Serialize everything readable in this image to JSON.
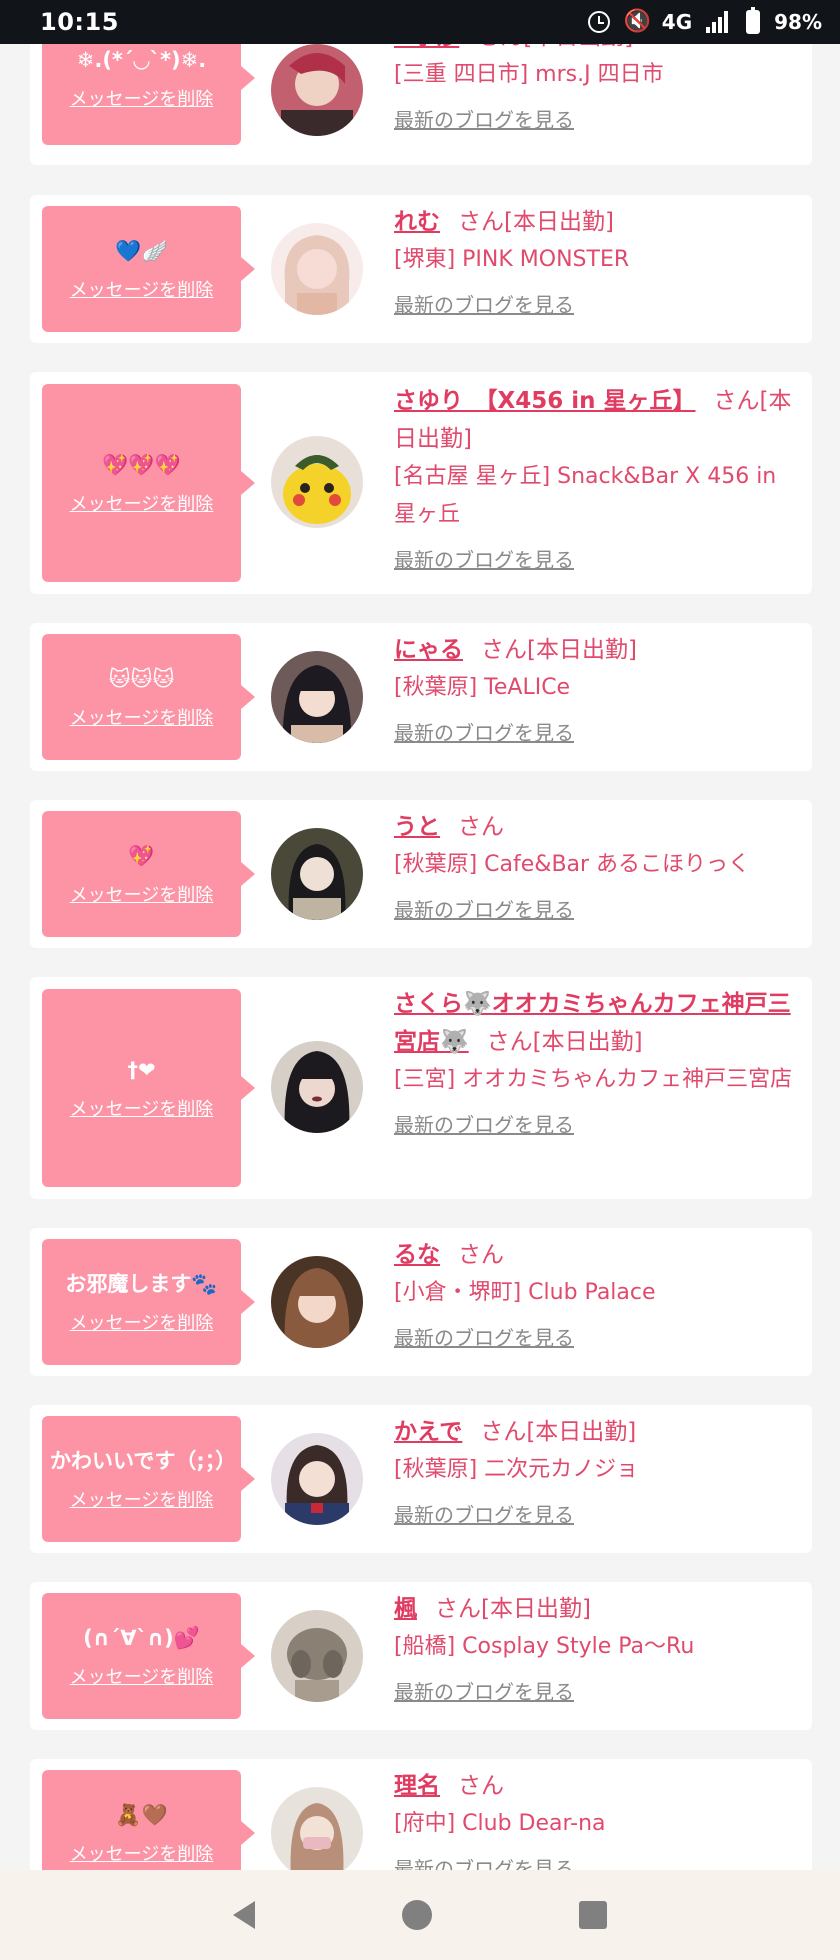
{
  "status_bar": {
    "time": "10:15",
    "network": "4G",
    "battery": "98%"
  },
  "cards": [
    {
      "msg": "❄.(*´◡`*)❄.",
      "delete": "メッセージを削除",
      "name": "❤季莎",
      "honor": "さん[本日出勤]",
      "shop": "[三重 四日市] mrs.J 四日市",
      "blog": "最新のブログを見る"
    },
    {
      "msg": "💙🪽",
      "delete": "メッセージを削除",
      "name": "れむ",
      "honor": "さん[本日出勤]",
      "shop": "[堺東] PINK MONSTER",
      "blog": "最新のブログを見る"
    },
    {
      "msg": "💖💖💖",
      "delete": "メッセージを削除",
      "name": "さゆり　【X456 in 星ヶ丘】",
      "honor": "さん[本日出勤]",
      "shop": "[名古屋 星ヶ丘] Snack&Bar X 456 in 星ヶ丘",
      "blog": "最新のブログを見る"
    },
    {
      "msg": "🐱🐱🐱",
      "delete": "メッセージを削除",
      "name": "にゃる",
      "honor": "さん[本日出勤]",
      "shop": "[秋葉原] TeALICe",
      "blog": "最新のブログを見る"
    },
    {
      "msg": "💖",
      "delete": "メッセージを削除",
      "name": "うと",
      "honor": "さん",
      "shop": "[秋葉原] Cafe&Bar あるこほりっく",
      "blog": "最新のブログを見る"
    },
    {
      "msg": "†❤",
      "delete": "メッセージを削除",
      "name": "さくら🐺オオカミちゃんカフェ神戸三宮店🐺",
      "honor": "さん[本日出勤]",
      "shop": "[三宮] オオカミちゃんカフェ神戸三宮店",
      "blog": "最新のブログを見る"
    },
    {
      "msg": "お邪魔します🐾",
      "delete": "メッセージを削除",
      "name": "るな",
      "honor": "さん",
      "shop": "[小倉・堺町] Club Palace",
      "blog": "最新のブログを見る"
    },
    {
      "msg": "かわいいです（;；）",
      "delete": "メッセージを削除",
      "name": "かえで",
      "honor": "さん[本日出勤]",
      "shop": "[秋葉原] 二次元カノジョ",
      "blog": "最新のブログを見る"
    },
    {
      "msg": "(∩´∀`∩)💕",
      "delete": "メッセージを削除",
      "name": "楓",
      "honor": "さん[本日出勤]",
      "shop": "[船橋] Cosplay Style Pa～Ru",
      "blog": "最新のブログを見る"
    },
    {
      "msg": "🧸🤎",
      "delete": "メッセージを削除",
      "name": "理名",
      "honor": "さん",
      "shop": "[府中] Club Dear-na",
      "blog": "最新のブログを見る"
    }
  ],
  "avatars": [
    {
      "label": "avatar-kisa",
      "colors": [
        "#c2606f",
        "#3a2a2c"
      ]
    },
    {
      "label": "avatar-remu",
      "colors": [
        "#f2d6d2",
        "#e4b9a8"
      ]
    },
    {
      "label": "avatar-sayuri",
      "colors": [
        "#f4d22a",
        "#3c5a2a"
      ]
    },
    {
      "label": "avatar-nyaru",
      "colors": [
        "#2a2530",
        "#d9bca8"
      ]
    },
    {
      "label": "avatar-uto",
      "colors": [
        "#3a3a2e",
        "#bfb4a2"
      ]
    },
    {
      "label": "avatar-sakura",
      "colors": [
        "#1c1a1e",
        "#e8d3c8"
      ]
    },
    {
      "label": "avatar-runa",
      "colors": [
        "#6a4530",
        "#e9c6b0"
      ]
    },
    {
      "label": "avatar-kaede",
      "colors": [
        "#2c3a6a",
        "#f1dcd0"
      ]
    },
    {
      "label": "avatar-kaede-maple",
      "colors": [
        "#8a8074",
        "#d8d0c6"
      ]
    },
    {
      "label": "avatar-rina",
      "colors": [
        "#b8907a",
        "#f0dfd2"
      ]
    }
  ]
}
